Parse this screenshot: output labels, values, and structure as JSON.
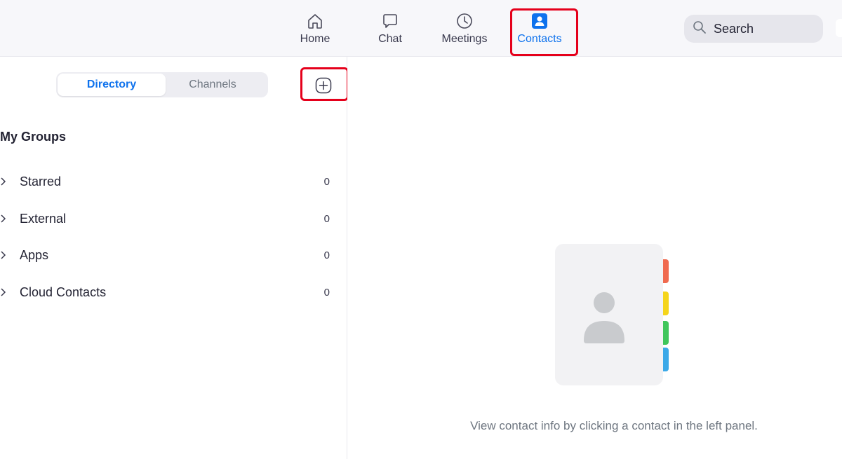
{
  "nav": {
    "tabs": [
      {
        "label": "Home",
        "icon": "home-icon"
      },
      {
        "label": "Chat",
        "icon": "chat-bubble-icon"
      },
      {
        "label": "Meetings",
        "icon": "clock-icon"
      },
      {
        "label": "Contacts",
        "icon": "contact-person-icon",
        "active": true
      }
    ],
    "search_label": "Search",
    "accent_color": "#0e72ed",
    "highlight_color": "#e5001b"
  },
  "left_panel": {
    "segments": [
      "Directory",
      "Channels"
    ],
    "selected_segment": "Directory",
    "add_button_icon": "plus-circle-icon",
    "groups_title": "My Groups",
    "groups": [
      {
        "name": "Starred",
        "count": "0"
      },
      {
        "name": "External",
        "count": "0"
      },
      {
        "name": "Apps",
        "count": "0"
      },
      {
        "name": "Cloud Contacts",
        "count": "0"
      }
    ]
  },
  "right_panel": {
    "illustration_icon": "address-book-icon",
    "tab_colors": [
      "#f06a4f",
      "#f5d51b",
      "#3fc65b",
      "#3ba9e8"
    ],
    "empty_message": "View contact info by clicking a contact in the left panel."
  }
}
